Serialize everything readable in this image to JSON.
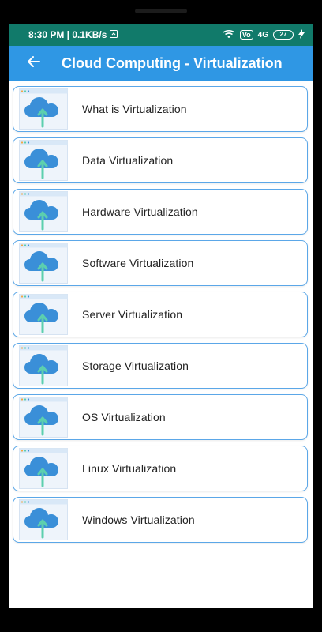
{
  "status_bar": {
    "time_network": "8:30 PM | 0.1KB/s",
    "badge_vol": "Vo",
    "badge_4g": "4G",
    "battery": "27"
  },
  "app_bar": {
    "title": "Cloud Computing - Virtualization"
  },
  "items": [
    {
      "label": "What is Virtualization"
    },
    {
      "label": "Data Virtualization"
    },
    {
      "label": "Hardware Virtualization"
    },
    {
      "label": "Software Virtualization"
    },
    {
      "label": "Server Virtualization"
    },
    {
      "label": "Storage Virtualization"
    },
    {
      "label": "OS Virtualization"
    },
    {
      "label": "Linux Virtualization"
    },
    {
      "label": "Windows Virtualization"
    }
  ],
  "icons": {
    "back": "arrow-back-icon",
    "item": "cloud-upload-icon"
  },
  "colors": {
    "status_bar": "#117a6a",
    "app_bar": "#2f97e4",
    "card_border": "#5ba7e8",
    "cloud": "#3a8fd8",
    "arrow": "#5ccfae"
  }
}
